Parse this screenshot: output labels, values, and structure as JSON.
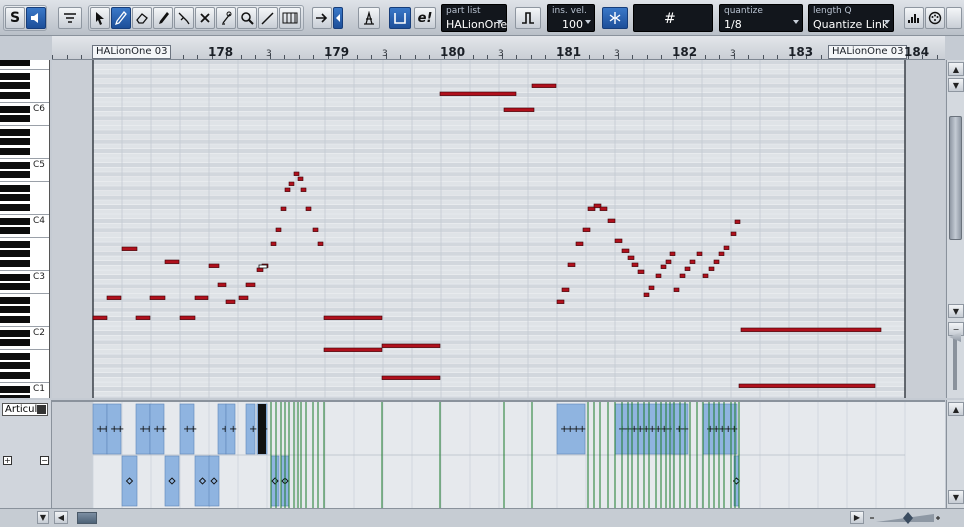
{
  "toolbar": {
    "part_list": {
      "label": "part list",
      "value": "HALionOne"
    },
    "ins_vel": {
      "label": "ins. vel.",
      "value": "100"
    },
    "quantize": {
      "label": "quantize",
      "value": "1/8"
    },
    "length_q": {
      "label": "length Q",
      "value": "Quantize Link"
    },
    "grid_symbol": "#",
    "solo_label": "S",
    "e_label": "e!",
    "icons": [
      "solo-icon",
      "listen-icon",
      "part-info-icon",
      "object-select-icon",
      "draw-icon",
      "erase-icon",
      "trim-icon",
      "split-icon",
      "glue-icon",
      "mute-icon",
      "pencil-line-icon",
      "zoom-icon",
      "line-icon",
      "color-icon",
      "autoscroll-icon",
      "step-input-icon",
      "drum-icon",
      "independent-track-loop-icon",
      "edit-in-place-icon",
      "insert-velocity-icon",
      "snap-icon",
      "grid-icon",
      "controller-icon",
      "tempo-icon"
    ],
    "accent": "#2a63b5"
  },
  "ruler": {
    "start_label": "HALionOne 03",
    "end_label": "HALionOne 03",
    "bars": [
      "178",
      "179",
      "180",
      "181",
      "182",
      "183",
      "184"
    ],
    "beat_label": "3"
  },
  "keyboard": {
    "octaves": [
      "C6",
      "C5",
      "C4",
      "C3",
      "C2",
      "C1"
    ]
  },
  "controller": {
    "lane_label": "Articula",
    "expand_label": "+",
    "collapse_label": "−"
  },
  "colors": {
    "note_fill": "#b0101c",
    "note_border": "#3a0006",
    "grid_bg": "#dfe3e7",
    "black_key_row": "#d2d7dd",
    "bar_line": "#8a96a6",
    "controller_block": "#8fb4e0",
    "controller_line": "#1a7a2a"
  }
}
